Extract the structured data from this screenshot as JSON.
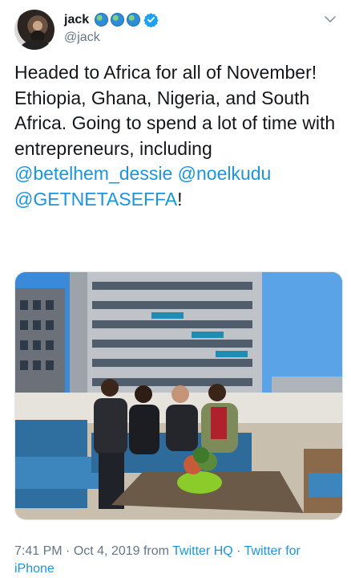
{
  "tweet": {
    "author": {
      "display_name": "jack",
      "handle": "@jack",
      "badges": [
        "globe-africa-emoji",
        "globe-africa-emoji",
        "globe-africa-emoji",
        "verified-badge"
      ],
      "avatar_icon": "avatar-photo"
    },
    "menu_icon": "chevron-down-icon",
    "text_parts": {
      "line1": "Headed to Africa for all of November! Ethiopia, Ghana, Nigeria, and South Africa. Going to spend a lot of time with entrepreneurs, including ",
      "mention1": "@betelhem_dessie",
      "space1": " ",
      "mention2": "@noelkudu",
      "space2": " ",
      "mention3": "@GETNETASEFFA",
      "end": "!"
    },
    "media": {
      "type": "photo",
      "description_icon": "photo-four-people-rooftop"
    },
    "meta": {
      "time": "7:41 PM",
      "sep1": " · ",
      "date": "Oct 4, 2019",
      "from": " from ",
      "location": "Twitter HQ",
      "sep2": " · ",
      "source": "Twitter for iPhone"
    }
  },
  "colors": {
    "link": "#1b95e0",
    "text": "#14171a",
    "secondary": "#657786",
    "verified": "#1da1f2"
  }
}
